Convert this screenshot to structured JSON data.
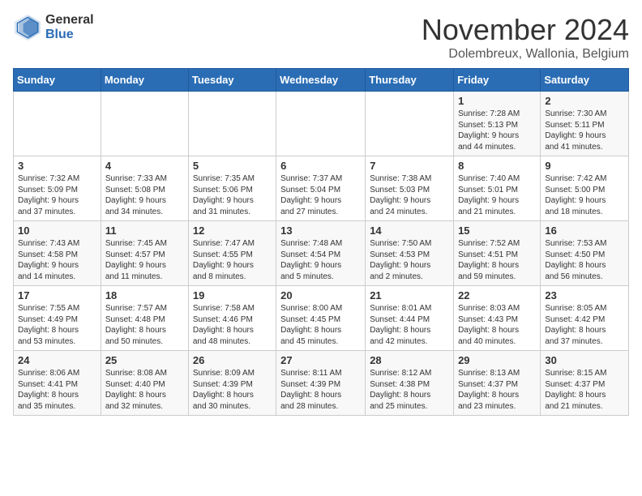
{
  "logo": {
    "general": "General",
    "blue": "Blue"
  },
  "title": "November 2024",
  "location": "Dolembreux, Wallonia, Belgium",
  "weekdays": [
    "Sunday",
    "Monday",
    "Tuesday",
    "Wednesday",
    "Thursday",
    "Friday",
    "Saturday"
  ],
  "weeks": [
    [
      {
        "day": "",
        "info": ""
      },
      {
        "day": "",
        "info": ""
      },
      {
        "day": "",
        "info": ""
      },
      {
        "day": "",
        "info": ""
      },
      {
        "day": "",
        "info": ""
      },
      {
        "day": "1",
        "info": "Sunrise: 7:28 AM\nSunset: 5:13 PM\nDaylight: 9 hours\nand 44 minutes."
      },
      {
        "day": "2",
        "info": "Sunrise: 7:30 AM\nSunset: 5:11 PM\nDaylight: 9 hours\nand 41 minutes."
      }
    ],
    [
      {
        "day": "3",
        "info": "Sunrise: 7:32 AM\nSunset: 5:09 PM\nDaylight: 9 hours\nand 37 minutes."
      },
      {
        "day": "4",
        "info": "Sunrise: 7:33 AM\nSunset: 5:08 PM\nDaylight: 9 hours\nand 34 minutes."
      },
      {
        "day": "5",
        "info": "Sunrise: 7:35 AM\nSunset: 5:06 PM\nDaylight: 9 hours\nand 31 minutes."
      },
      {
        "day": "6",
        "info": "Sunrise: 7:37 AM\nSunset: 5:04 PM\nDaylight: 9 hours\nand 27 minutes."
      },
      {
        "day": "7",
        "info": "Sunrise: 7:38 AM\nSunset: 5:03 PM\nDaylight: 9 hours\nand 24 minutes."
      },
      {
        "day": "8",
        "info": "Sunrise: 7:40 AM\nSunset: 5:01 PM\nDaylight: 9 hours\nand 21 minutes."
      },
      {
        "day": "9",
        "info": "Sunrise: 7:42 AM\nSunset: 5:00 PM\nDaylight: 9 hours\nand 18 minutes."
      }
    ],
    [
      {
        "day": "10",
        "info": "Sunrise: 7:43 AM\nSunset: 4:58 PM\nDaylight: 9 hours\nand 14 minutes."
      },
      {
        "day": "11",
        "info": "Sunrise: 7:45 AM\nSunset: 4:57 PM\nDaylight: 9 hours\nand 11 minutes."
      },
      {
        "day": "12",
        "info": "Sunrise: 7:47 AM\nSunset: 4:55 PM\nDaylight: 9 hours\nand 8 minutes."
      },
      {
        "day": "13",
        "info": "Sunrise: 7:48 AM\nSunset: 4:54 PM\nDaylight: 9 hours\nand 5 minutes."
      },
      {
        "day": "14",
        "info": "Sunrise: 7:50 AM\nSunset: 4:53 PM\nDaylight: 9 hours\nand 2 minutes."
      },
      {
        "day": "15",
        "info": "Sunrise: 7:52 AM\nSunset: 4:51 PM\nDaylight: 8 hours\nand 59 minutes."
      },
      {
        "day": "16",
        "info": "Sunrise: 7:53 AM\nSunset: 4:50 PM\nDaylight: 8 hours\nand 56 minutes."
      }
    ],
    [
      {
        "day": "17",
        "info": "Sunrise: 7:55 AM\nSunset: 4:49 PM\nDaylight: 8 hours\nand 53 minutes."
      },
      {
        "day": "18",
        "info": "Sunrise: 7:57 AM\nSunset: 4:48 PM\nDaylight: 8 hours\nand 50 minutes."
      },
      {
        "day": "19",
        "info": "Sunrise: 7:58 AM\nSunset: 4:46 PM\nDaylight: 8 hours\nand 48 minutes."
      },
      {
        "day": "20",
        "info": "Sunrise: 8:00 AM\nSunset: 4:45 PM\nDaylight: 8 hours\nand 45 minutes."
      },
      {
        "day": "21",
        "info": "Sunrise: 8:01 AM\nSunset: 4:44 PM\nDaylight: 8 hours\nand 42 minutes."
      },
      {
        "day": "22",
        "info": "Sunrise: 8:03 AM\nSunset: 4:43 PM\nDaylight: 8 hours\nand 40 minutes."
      },
      {
        "day": "23",
        "info": "Sunrise: 8:05 AM\nSunset: 4:42 PM\nDaylight: 8 hours\nand 37 minutes."
      }
    ],
    [
      {
        "day": "24",
        "info": "Sunrise: 8:06 AM\nSunset: 4:41 PM\nDaylight: 8 hours\nand 35 minutes."
      },
      {
        "day": "25",
        "info": "Sunrise: 8:08 AM\nSunset: 4:40 PM\nDaylight: 8 hours\nand 32 minutes."
      },
      {
        "day": "26",
        "info": "Sunrise: 8:09 AM\nSunset: 4:39 PM\nDaylight: 8 hours\nand 30 minutes."
      },
      {
        "day": "27",
        "info": "Sunrise: 8:11 AM\nSunset: 4:39 PM\nDaylight: 8 hours\nand 28 minutes."
      },
      {
        "day": "28",
        "info": "Sunrise: 8:12 AM\nSunset: 4:38 PM\nDaylight: 8 hours\nand 25 minutes."
      },
      {
        "day": "29",
        "info": "Sunrise: 8:13 AM\nSunset: 4:37 PM\nDaylight: 8 hours\nand 23 minutes."
      },
      {
        "day": "30",
        "info": "Sunrise: 8:15 AM\nSunset: 4:37 PM\nDaylight: 8 hours\nand 21 minutes."
      }
    ]
  ]
}
